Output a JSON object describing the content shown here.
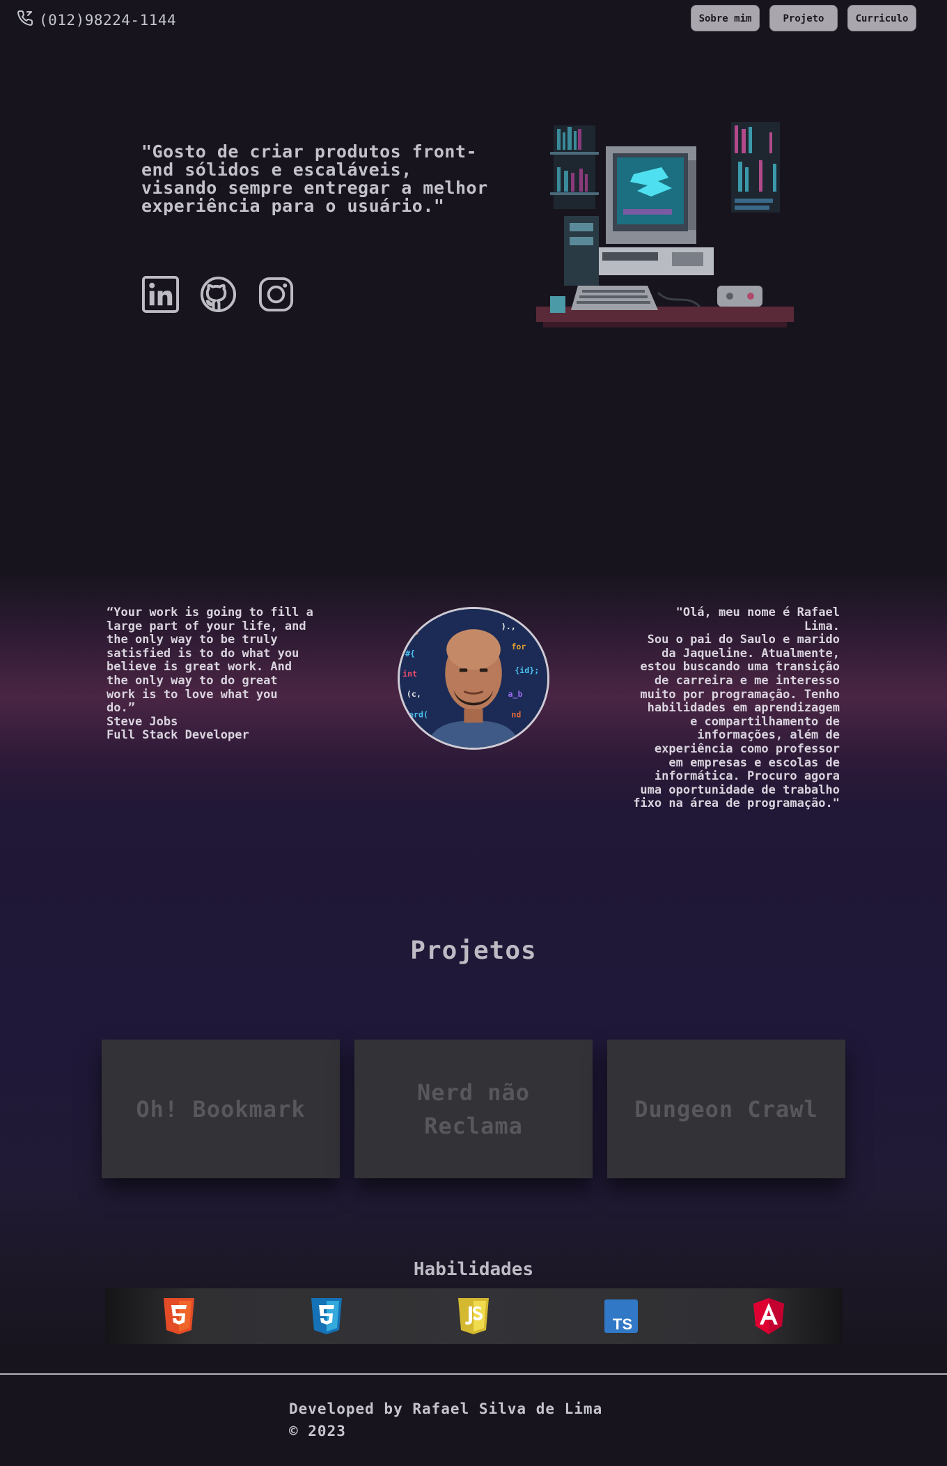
{
  "header": {
    "phone": "(012)98224-1144",
    "nav": [
      "Sobre mim",
      "Projeto",
      "Curriculo"
    ]
  },
  "hero": {
    "quote": "\"Gosto de criar produtos front-end sólidos e escaláveis, visando sempre entregar a melhor experiência para o usuário.\"",
    "socials": [
      "linkedin-icon",
      "github-icon",
      "instagram-icon"
    ]
  },
  "about": {
    "quote_lines": [
      "“Your work is going to fill a",
      "large part of your life, and",
      "the only way to be truly",
      "satisfied is to do what you",
      "believe is great work. And",
      "the only way to do great",
      "work is to love what you",
      "do.”",
      "Steve Jobs",
      "Full Stack Developer"
    ],
    "bio_lines": [
      "\"Olá, meu nome é Rafael",
      "Lima.",
      "Sou o pai do Saulo e marido",
      "da Jaqueline. Atualmente,",
      "estou buscando uma transição",
      "de carreira e me interesso",
      "muito por programação. Tenho",
      "habilidades em aprendizagem",
      "e compartilhamento de",
      "informações, além de",
      "experiência como professor",
      "em empresas e escolas de",
      "informática. Procuro agora",
      "uma oportunidade de trabalho",
      "fixo na área de programação.\""
    ]
  },
  "projects": {
    "title": "Projetos",
    "cards": [
      "Oh! Bookmark",
      "Nerd não Reclama",
      "Dungeon Crawl"
    ]
  },
  "skills": {
    "title": "Habilidades",
    "icons": [
      "html5-icon",
      "css3-icon",
      "javascript-icon",
      "typescript-icon",
      "angular-icon"
    ]
  },
  "footer": {
    "line1": "Developed by Rafael Silva de Lima",
    "line2": "© 2023"
  },
  "colors": {
    "background": "#17141d",
    "gradient_accent": "#4a2544",
    "card": "#333236",
    "nav_button": "#a9a6ad"
  }
}
